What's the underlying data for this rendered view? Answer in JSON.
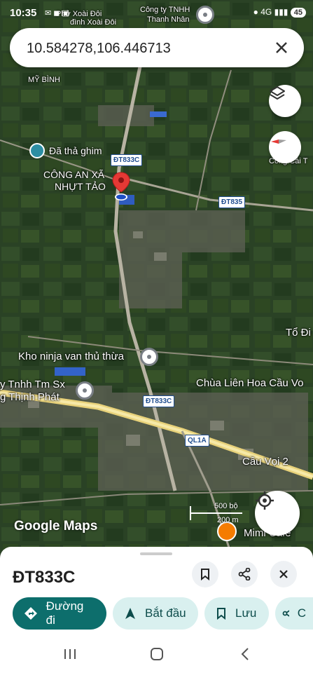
{
  "status_bar": {
    "time": "10:35",
    "battery": "45",
    "signal": "4G"
  },
  "search": {
    "value": "10.584278,106.446713"
  },
  "map": {
    "place_labels": {
      "top_left_place": "Phở Xoài Đôi",
      "top_left_place_full": "đình Xoài Đôi",
      "top_company": "Công ty TNHH",
      "top_company_2": "Thanh Nhân",
      "my_binh": "MỸ BÌNH",
      "dropped_pin": "Đã thả ghim",
      "police": "CÔNG AN XÃ",
      "police_2": "NHỰT TẢO",
      "cong_cai": "Cống Cái T",
      "to_di": "Tổ Đi",
      "kho_ninja": "Kho ninja van thủ thừa",
      "company_left": "y Tnhh Tm Sx",
      "company_left_2": "g Thịnh Phát",
      "chua": "Chùa Liên Hoa Cầu Vo",
      "cau_voi": "Cầu Vọi 2",
      "minicafe": "Mimi Cafe"
    },
    "road_shields": [
      "ĐT833C",
      "ĐT835",
      "ĐT833C",
      "QL1A"
    ],
    "scale": {
      "top": "500 bộ",
      "bottom": "200 m"
    },
    "logo": "Google Maps"
  },
  "sheet": {
    "title": "ĐT833C",
    "chips": {
      "directions": "Đường đi",
      "start": "Bắt đầu",
      "save": "Lưu",
      "share": "C"
    }
  },
  "colors": {
    "accent": "#0d6e6c",
    "chip_bg": "#d9f0ef",
    "pin": "#e53935"
  }
}
